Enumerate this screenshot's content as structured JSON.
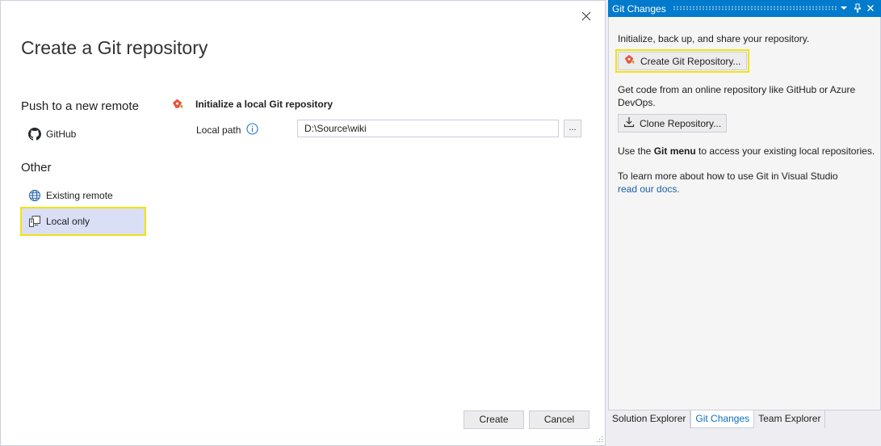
{
  "dialog": {
    "title": "Create a Git repository",
    "push_section": "Push to a new remote",
    "github_label": "GitHub",
    "other_section": "Other",
    "existing_remote_label": "Existing remote",
    "local_only_label": "Local only",
    "init_title": "Initialize a local Git repository",
    "local_path_label": "Local path",
    "local_path_value": "D:\\Source\\wiki",
    "browse_label": "...",
    "create_label": "Create",
    "cancel_label": "Cancel",
    "selected_item": "Local only"
  },
  "panel": {
    "title": "Git Changes",
    "intro": "Initialize, back up, and share your repository.",
    "create_repo_label": "Create Git Repository...",
    "online_text": "Get code from an online repository like GitHub or Azure DevOps.",
    "clone_label": "Clone Repository...",
    "git_menu_prefix": "Use the ",
    "git_menu_bold": "Git menu",
    "git_menu_suffix": " to access your existing local repositories.",
    "learn_text": "To learn more about how to use Git in Visual Studio",
    "docs_link": "read our docs."
  },
  "tabs": [
    {
      "label": "Solution Explorer",
      "active": false
    },
    {
      "label": "Git Changes",
      "active": true
    },
    {
      "label": "Team Explorer",
      "active": false
    }
  ],
  "icons": {
    "close": "close-icon",
    "github": "github-icon",
    "existing_remote": "globe-icon",
    "local_only": "computer-icon",
    "git_repo": "git-repo-icon",
    "info": "info-icon",
    "clone": "download-icon",
    "dropdown": "chevron-down-icon",
    "pin": "pin-icon"
  },
  "colors": {
    "accent": "#007acc",
    "highlight": "#f2e20f",
    "selected_bg": "#dadff5",
    "link": "#1a5eaa"
  }
}
